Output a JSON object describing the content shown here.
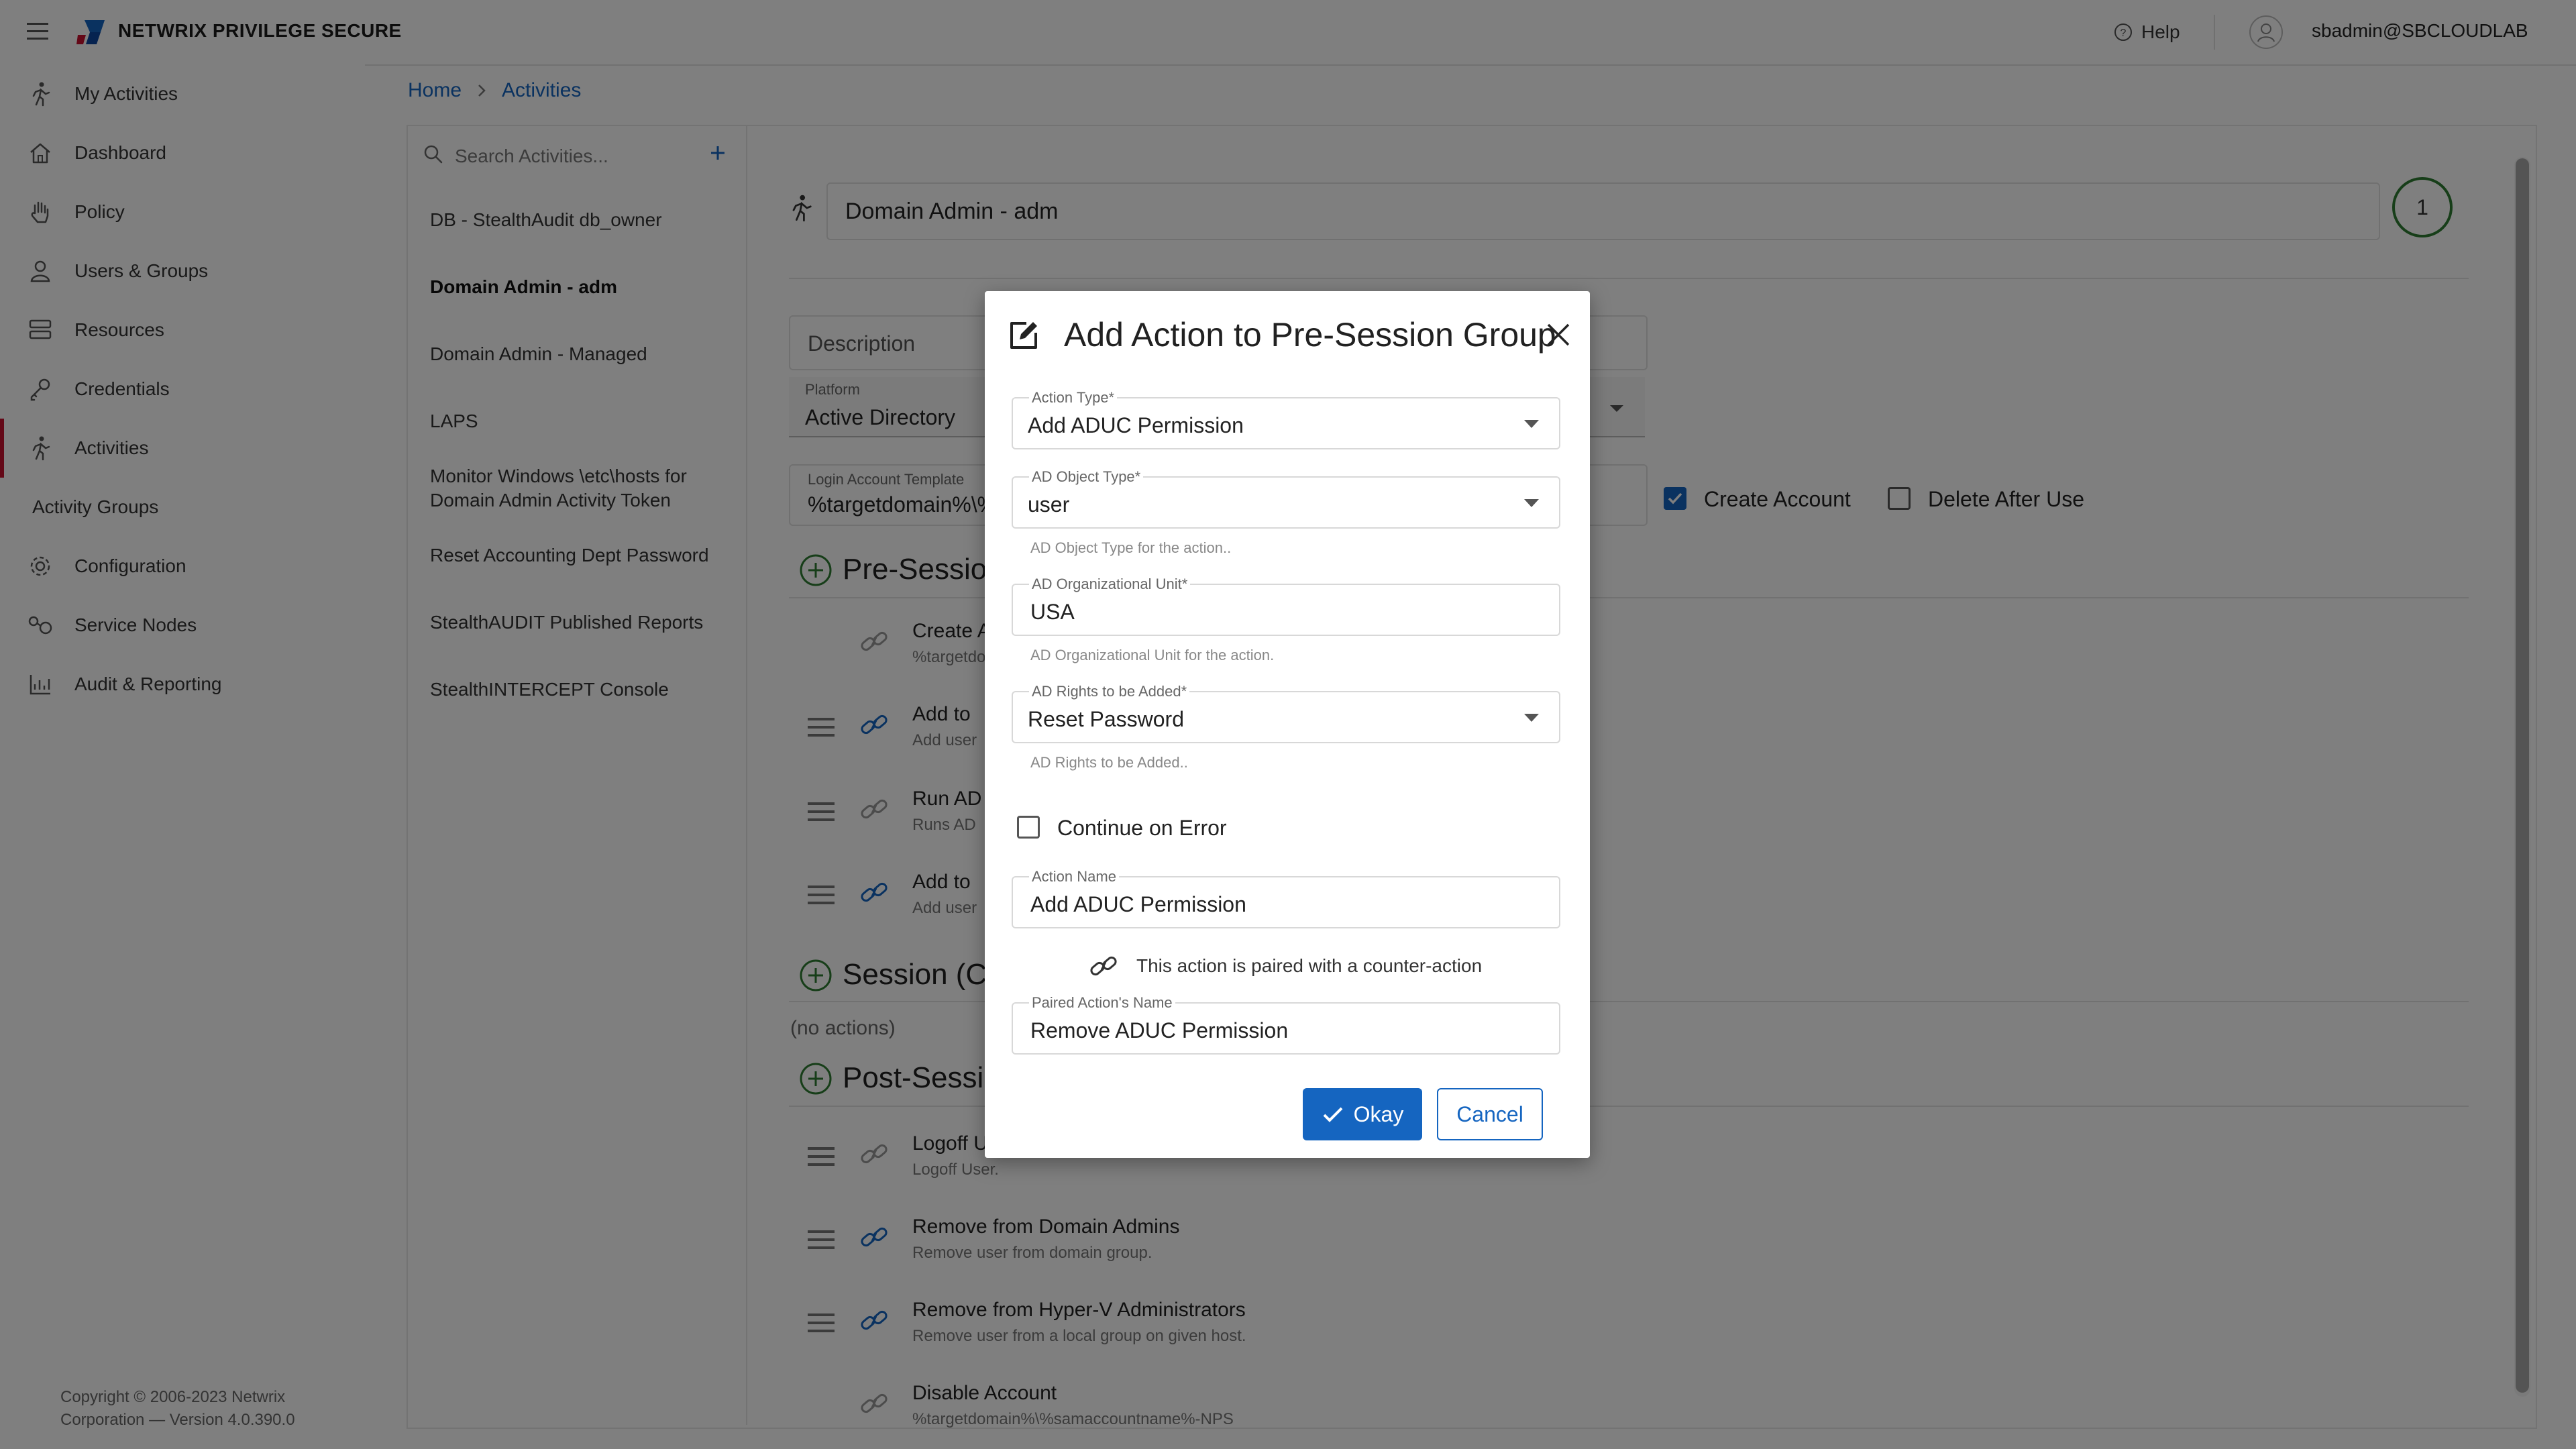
{
  "header": {
    "brand": "NETWRIX PRIVILEGE SECURE",
    "help": "Help",
    "user": "sbadmin@SBCLOUDLAB"
  },
  "sidebar": {
    "items": [
      {
        "label": "My Activities",
        "icon": "runner-icon"
      },
      {
        "label": "Dashboard",
        "icon": "home-icon"
      },
      {
        "label": "Policy",
        "icon": "hand-icon"
      },
      {
        "label": "Users & Groups",
        "icon": "user-icon"
      },
      {
        "label": "Resources",
        "icon": "server-icon"
      },
      {
        "label": "Credentials",
        "icon": "key-icon"
      },
      {
        "label": "Activities",
        "icon": "runner-icon"
      },
      {
        "label": "Activity Groups",
        "icon": ""
      },
      {
        "label": "Configuration",
        "icon": "gear-icon"
      },
      {
        "label": "Service Nodes",
        "icon": "nodes-icon"
      },
      {
        "label": "Audit & Reporting",
        "icon": "chart-icon"
      }
    ],
    "copyright_line1": "Copyright © 2006-2023 Netwrix",
    "copyright_line2": "Corporation — Version 4.0.390.0"
  },
  "breadcrumb": {
    "home": "Home",
    "current": "Activities"
  },
  "activities_list": {
    "search_placeholder": "Search Activities...",
    "items": [
      "DB - StealthAudit db_owner",
      "Domain Admin - adm",
      "Domain Admin - Managed",
      "LAPS",
      "Monitor Windows \\etc\\hosts for Domain Admin Activity Token",
      "Reset Accounting Dept Password",
      "StealthAUDIT Published Reports",
      "StealthINTERCEPT Console"
    ]
  },
  "detail": {
    "name": "Domain Admin - adm",
    "step": "1",
    "description_label": "Description",
    "platform_label": "Platform",
    "platform_value": "Active Directory",
    "login_template_label": "Login Account Template",
    "login_template_value": "%targetdomain%\\%",
    "create_account": "Create Account",
    "delete_after_use": "Delete After Use",
    "pre_session": "Pre-Session",
    "session": "Session (Co",
    "post_session": "Post-Sessio",
    "no_actions": "(no actions)",
    "pre_actions": [
      {
        "title": "Create A",
        "sub": "%targetdo"
      },
      {
        "title": "Add to",
        "sub": "Add user"
      },
      {
        "title": "Run AD",
        "sub": "Runs AD"
      },
      {
        "title": "Add to",
        "sub": "Add user"
      }
    ],
    "post_actions": [
      {
        "title": "Logoff U",
        "sub": "Logoff User."
      },
      {
        "title": "Remove from Domain Admins",
        "sub": "Remove user from domain group."
      },
      {
        "title": "Remove from Hyper-V Administrators",
        "sub": "Remove user from a local group on given host."
      },
      {
        "title": "Disable Account",
        "sub": "%targetdomain%\\%samaccountname%-NPS"
      }
    ]
  },
  "dialog": {
    "title": "Add Action to Pre-Session Group",
    "action_type_label": "Action Type*",
    "action_type_value": "Add ADUC Permission",
    "ad_object_type_label": "AD Object Type*",
    "ad_object_type_value": "user",
    "ad_object_type_help": "AD Object Type for the action..",
    "ad_ou_label": "AD Organizational Unit*",
    "ad_ou_value": "USA",
    "ad_ou_help": "AD Organizational Unit for the action.",
    "ad_rights_label": "AD Rights to be Added*",
    "ad_rights_value": "Reset Password",
    "ad_rights_help": "AD Rights to be Added..",
    "continue_on_error": "Continue on Error",
    "action_name_label": "Action Name",
    "action_name_value": "Add ADUC Permission",
    "paired_note": "This action is paired with a counter-action",
    "paired_name_label": "Paired Action's Name",
    "paired_name_value": "Remove ADUC Permission",
    "okay": "Okay",
    "cancel": "Cancel"
  },
  "colors": {
    "accent": "#1565c0",
    "active_marker": "#c8102e",
    "step_ring": "#2e7d32",
    "add_green": "#2e7d32"
  }
}
